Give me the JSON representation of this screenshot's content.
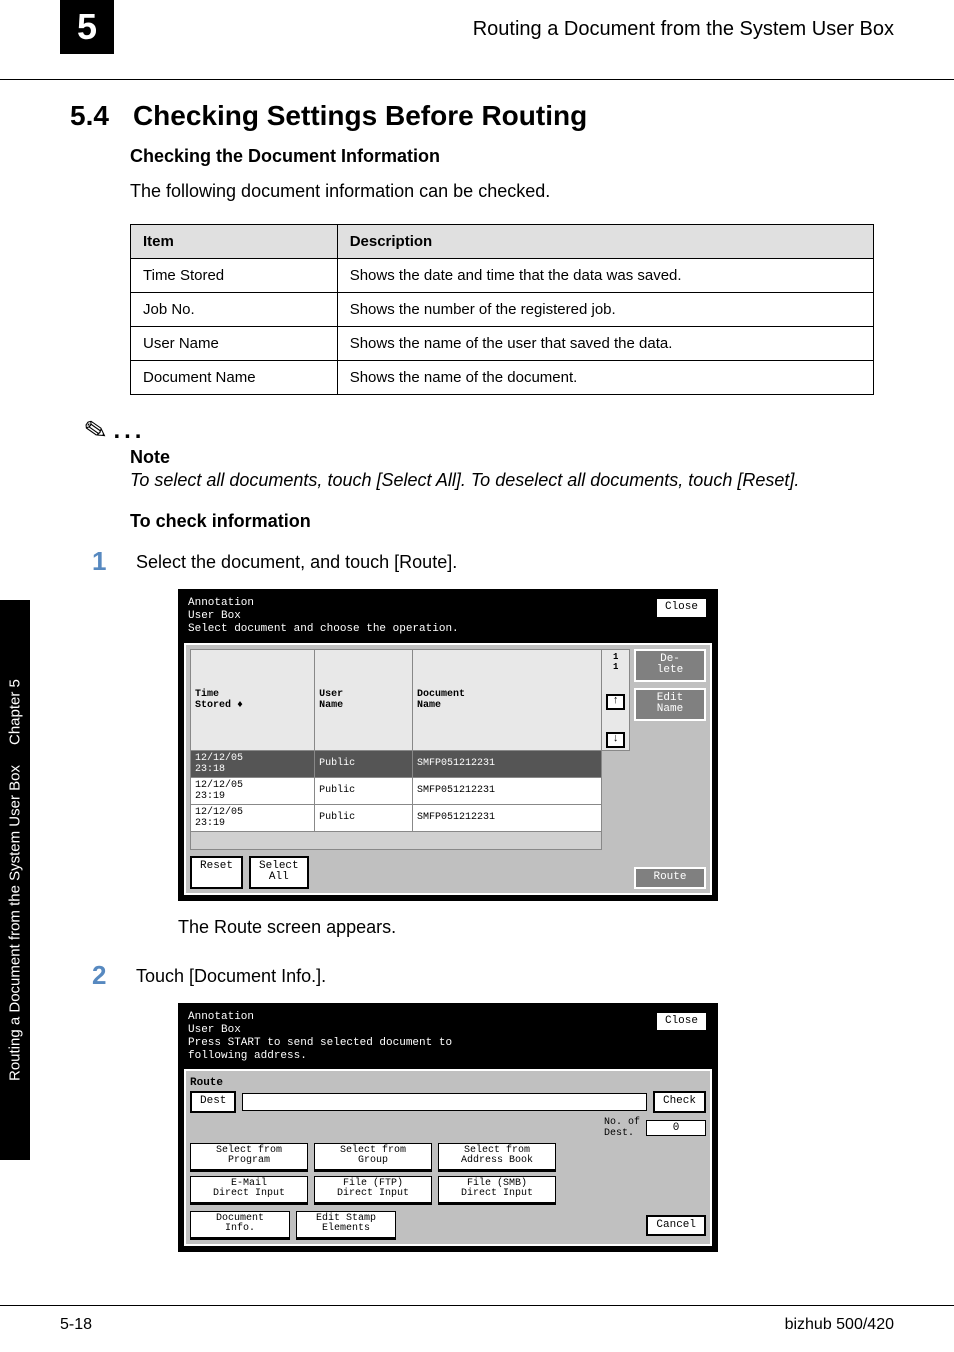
{
  "header": {
    "chapter_badge": "5",
    "running_title": "Routing a Document from the System User Box"
  },
  "section": {
    "number": "5.4",
    "title": "Checking Settings Before Routing",
    "subhead1": "Checking the Document Information",
    "intro": "The following document information can be checked."
  },
  "info_table": {
    "headers": {
      "item": "Item",
      "description": "Description"
    },
    "rows": [
      {
        "item": "Time Stored",
        "description": "Shows the date and time that the data was saved."
      },
      {
        "item": "Job No.",
        "description": "Shows the number of the registered job."
      },
      {
        "item": "User Name",
        "description": "Shows the name of the user that saved the data."
      },
      {
        "item": "Document Name",
        "description": "Shows the name of the document."
      }
    ]
  },
  "note": {
    "dots": "...",
    "title": "Note",
    "text": "To select all documents, touch [Select All]. To deselect all documents, touch [Reset]."
  },
  "to_check": {
    "heading": "To check information",
    "step1_num": "1",
    "step1_text": "Select the document, and touch [Route].",
    "step1_result": "The Route screen appears.",
    "step2_num": "2",
    "step2_text": "Touch [Document Info.]."
  },
  "panel1": {
    "title_line1": "Annotation\nUser Box",
    "instructions": "Select document and choose the operation.",
    "close": "Close",
    "col_time": "Time\nStored",
    "col_sort": "♦",
    "col_user": "User\nName",
    "col_doc": "Document\nName",
    "rows": [
      {
        "time": "12/12/05\n23:18",
        "user": "Public",
        "doc": "SMFP051212231",
        "selected": true
      },
      {
        "time": "12/12/05\n23:19",
        "user": "Public",
        "doc": "SMFP051212231",
        "selected": false
      },
      {
        "time": "12/12/05\n23:19",
        "user": "Public",
        "doc": "SMFP051212231",
        "selected": false
      }
    ],
    "page_indicator": "1\n1",
    "arrow_up": "↑",
    "arrow_down": "↓",
    "reset": "Reset",
    "select_all": "Select\nAll",
    "delete": "De-\nlete",
    "edit_name": "Edit\nName",
    "route": "Route"
  },
  "panel2": {
    "title_line1": "Annotation\nUser Box",
    "instructions": "Press START to send selected document to\nfollowing address.",
    "close": "Close",
    "route_label": "Route",
    "dest_label": "Dest",
    "check": "Check",
    "count_label": "No. of\nDest.",
    "count_value": "0",
    "select_program": "Select from\nProgram",
    "select_group": "Select from\nGroup",
    "select_address": "Select from\nAddress Book",
    "email_direct": "E-Mail\nDirect Input",
    "ftp_direct": "File (FTP)\nDirect Input",
    "smb_direct": "File (SMB)\nDirect Input",
    "doc_info": "Document\nInfo.",
    "edit_stamp": "Edit Stamp\nElements",
    "cancel": "Cancel"
  },
  "sidebar": {
    "chapter_label": "Chapter 5",
    "book_title": "Routing a Document from the System User Box"
  },
  "footer": {
    "page": "5-18",
    "model": "bizhub 500/420"
  }
}
